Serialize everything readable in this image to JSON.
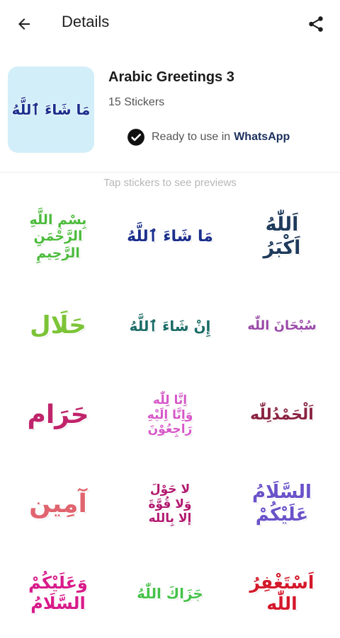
{
  "appbar": {
    "title": "Details",
    "back_icon": "arrow-back-icon",
    "share_icon": "share-icon"
  },
  "pack": {
    "tray_text": "مَا شَاءَ ٱللَّهُ",
    "name": "Arabic Greetings 3",
    "count": "15 Stickers",
    "ready_text": "Ready to use in",
    "ready_app": "WhatsApp",
    "status_icon": "check-circle-icon"
  },
  "hint": "Tap stickers to see previews",
  "colors": {
    "tray_bg": "#d2eef9",
    "navy": "#1b2f8c"
  },
  "stickers": [
    {
      "text": "بِسْمِ اللَّهِ\nالرَّحْمَنِ\nالرَّحِيمِ",
      "color": "#4cbb3c"
    },
    {
      "text": "مَا شَاءَ ٱللَّهُ",
      "color": "#1b2f8c"
    },
    {
      "text": "اَللّٰهُ\nاَكْبَرُ",
      "color": "#1e3a5c"
    },
    {
      "text": "حَلَال",
      "color": "#7cc437"
    },
    {
      "text": "إِنْ شَاءَ ٱللَّهُ",
      "color": "#1a6b66"
    },
    {
      "text": "سُبْحَانَ اللّٰه",
      "color": "#9a4aa8"
    },
    {
      "text": "حَرَام",
      "color": "#c0246a"
    },
    {
      "text": "اِنَّا لِلّٰه\nوَاِنَّا اِلَيْهِ\nرَاجِعُوْنَ",
      "color": "#d657c8"
    },
    {
      "text": "اَلْحَمْدُلِلّٰه",
      "color": "#8a2240"
    },
    {
      "text": "آمِين",
      "color": "#e0646e"
    },
    {
      "text": "لا حَوْلَ\nوَلا قُوَّةَ\nإلا بِالله",
      "color": "#b2186f"
    },
    {
      "text": "السَّلَامُ\nعَلَيْكُمْ",
      "color": "#6a52c9"
    },
    {
      "text": "وَعَلَيْكُمْ\nالسَّلَامُ",
      "color": "#d81b8a"
    },
    {
      "text": "جَزَاكَ اللّٰهُ",
      "color": "#45c24a"
    },
    {
      "text": "اَسْتَغْفِرُ\nاللّٰه",
      "color": "#d4182a"
    }
  ]
}
